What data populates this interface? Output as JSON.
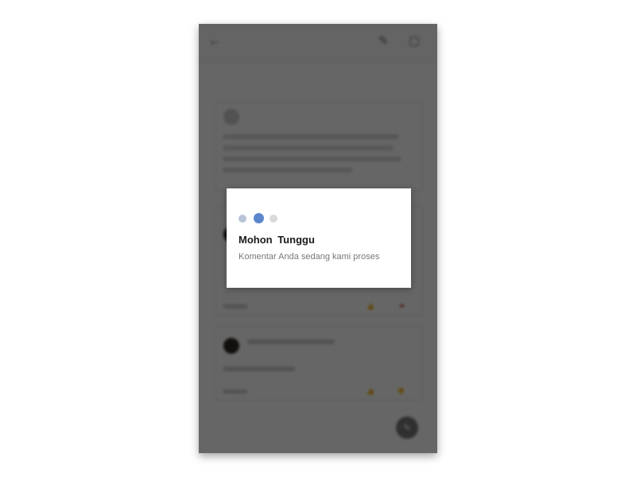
{
  "appbar": {
    "back_icon": "arrow-left-icon",
    "edit_icon": "pencil-icon",
    "share_icon": "share-icon"
  },
  "dialog": {
    "title": "Mohon  Tunggu",
    "message": "Komentar Anda sedang kami proses",
    "loading_dots": [
      "#b7c4d9",
      "#5b86cc",
      "#d9d9d9"
    ]
  },
  "colors": {
    "scrim": "rgba(0,0,0,0.6)",
    "accent": "#5b86cc"
  }
}
